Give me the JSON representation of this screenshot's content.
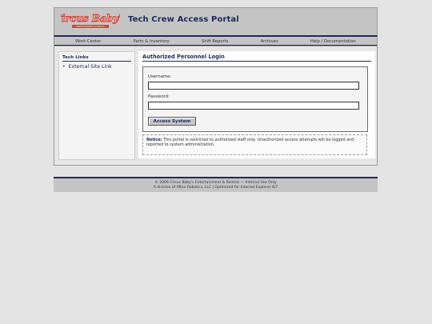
{
  "header": {
    "logo_line1": "Circus Baby's",
    "logo_line2": "ENTERTAINMENT & RENTAL",
    "title": "Tech Crew Access Portal"
  },
  "nav": {
    "items": [
      "Work Center",
      "Parts & Inventory",
      "Shift Reports",
      "Archives",
      "Help / Documentation"
    ]
  },
  "sidebar": {
    "heading": "Tech Links",
    "links": [
      "External Site Link"
    ]
  },
  "login": {
    "heading": "Authorized Personnel Login",
    "username_label": "Username:",
    "username_value": "",
    "password_label": "Password:",
    "password_value": "",
    "submit_label": "Access System"
  },
  "notice": {
    "label": "Notice:",
    "text": "This portal is restricted to authorized staff only. Unauthorized access attempts will be logged and reported to system administration."
  },
  "footer": {
    "line1": "© 2006 Circus Baby's Entertainment & Rentals — Internal Use Only",
    "line2": "A division of Afton Robotics, LLC | Optimized for Internet Explorer 6/7"
  },
  "colors": {
    "brand_navy": "#1c2a5a",
    "logo_red": "#d2453a",
    "logo_pink": "#f7b6ad"
  }
}
